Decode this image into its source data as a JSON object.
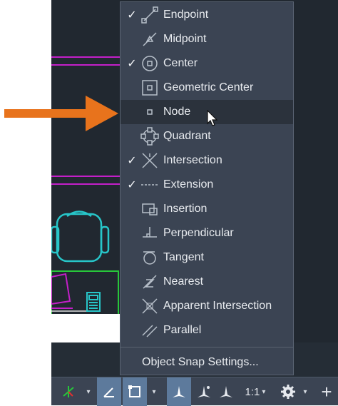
{
  "menu": {
    "items": [
      {
        "label": "Endpoint",
        "checked": true,
        "icon": "endpoint-snap-icon"
      },
      {
        "label": "Midpoint",
        "checked": false,
        "icon": "midpoint-snap-icon"
      },
      {
        "label": "Center",
        "checked": true,
        "icon": "center-snap-icon"
      },
      {
        "label": "Geometric Center",
        "checked": false,
        "icon": "geometric-center-snap-icon"
      },
      {
        "label": "Node",
        "checked": false,
        "icon": "node-snap-icon",
        "hovered": true
      },
      {
        "label": "Quadrant",
        "checked": false,
        "icon": "quadrant-snap-icon"
      },
      {
        "label": "Intersection",
        "checked": true,
        "icon": "intersection-snap-icon"
      },
      {
        "label": "Extension",
        "checked": true,
        "icon": "extension-snap-icon"
      },
      {
        "label": "Insertion",
        "checked": false,
        "icon": "insertion-snap-icon"
      },
      {
        "label": "Perpendicular",
        "checked": false,
        "icon": "perpendicular-snap-icon"
      },
      {
        "label": "Tangent",
        "checked": false,
        "icon": "tangent-snap-icon"
      },
      {
        "label": "Nearest",
        "checked": false,
        "icon": "nearest-snap-icon"
      },
      {
        "label": "Apparent Intersection",
        "checked": false,
        "icon": "apparent-intersection-snap-icon"
      },
      {
        "label": "Parallel",
        "checked": false,
        "icon": "parallel-snap-icon"
      }
    ],
    "settings_label": "Object Snap Settings...",
    "check_glyph": "✓"
  },
  "statusbar": {
    "scale_label": "1:1",
    "caret": "▾",
    "plus": "+"
  },
  "colors": {
    "menu_bg": "#3b4453",
    "hover_bg": "#2b323c",
    "canvas_bg": "#212830",
    "arrow": "#e8731c",
    "magenta": "#c41fc9",
    "cyan": "#27c6c9",
    "green": "#27c63a",
    "active_button": "#5d7a9c"
  }
}
